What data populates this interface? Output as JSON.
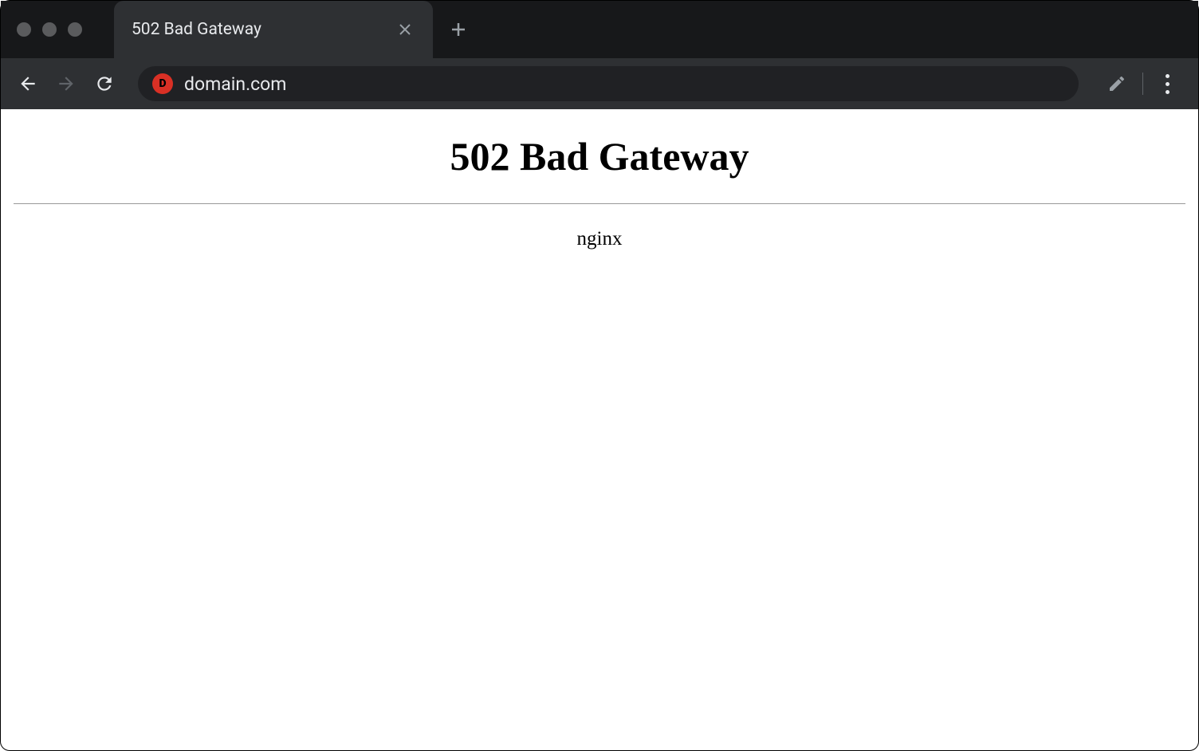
{
  "tab": {
    "title": "502 Bad Gateway"
  },
  "address": {
    "url": "domain.com"
  },
  "page": {
    "heading": "502 Bad Gateway",
    "server": "nginx"
  }
}
